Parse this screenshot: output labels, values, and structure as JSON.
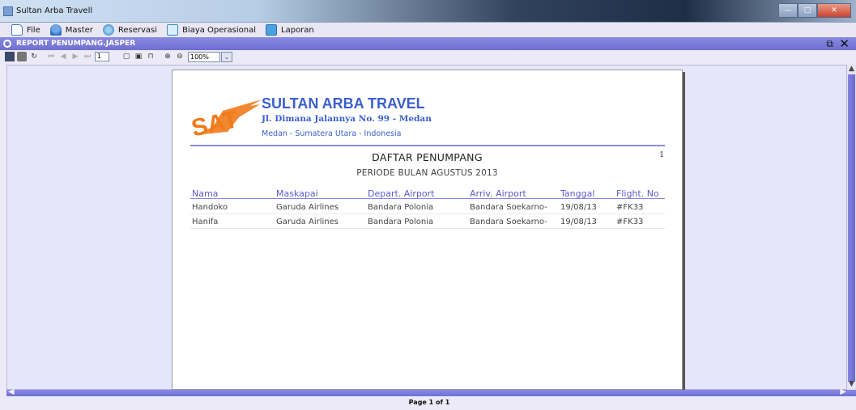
{
  "window": {
    "title": "Sultan Arba Travell",
    "controls": {
      "minimize": "—",
      "maximize": "□",
      "close": "✕"
    }
  },
  "menu": {
    "items": [
      {
        "label": "File",
        "icon": "file-icon"
      },
      {
        "label": "Master",
        "icon": "master-icon"
      },
      {
        "label": "Reservasi",
        "icon": "reservasi-icon"
      },
      {
        "label": "Biaya Operasional",
        "icon": "biaya-icon"
      },
      {
        "label": "Laporan",
        "icon": "laporan-icon"
      }
    ]
  },
  "frame": {
    "title": "REPORT PENUMPANG.JASPER"
  },
  "toolbar": {
    "page_value": "1",
    "zoom_value": "100%"
  },
  "status": {
    "page_label": "Page 1 of 1"
  },
  "report": {
    "logo_text": "SAT",
    "company_name": "SULTAN ARBA TRAVEL",
    "address": "Jl. Dimana Jalannya No. 99 - Medan",
    "city": "Medan - Sumatera Utara - Indonesia",
    "title": "DAFTAR PENUMPANG",
    "subtitle": "PERIODE BULAN AGUSTUS 2013",
    "page_number": "1",
    "columns": [
      "Nama",
      "Maskapai",
      "Depart. Airport",
      "Arriv. Airport",
      "Tanggal",
      "Flight. No"
    ],
    "rows": [
      [
        "Handoko",
        "Garuda Airlines",
        "Bandara Polonia",
        "Bandara Soekarno-",
        "19/08/13",
        "#FK33"
      ],
      [
        "Hanifa",
        "Garuda Airlines",
        "Bandara Polonia",
        "Bandara Soekarno-",
        "19/08/13",
        "#FK33"
      ]
    ]
  },
  "colors": {
    "accent": "#3a5fcd",
    "logo_orange": "#f07a1a",
    "frame_bar": "#7373d6"
  }
}
